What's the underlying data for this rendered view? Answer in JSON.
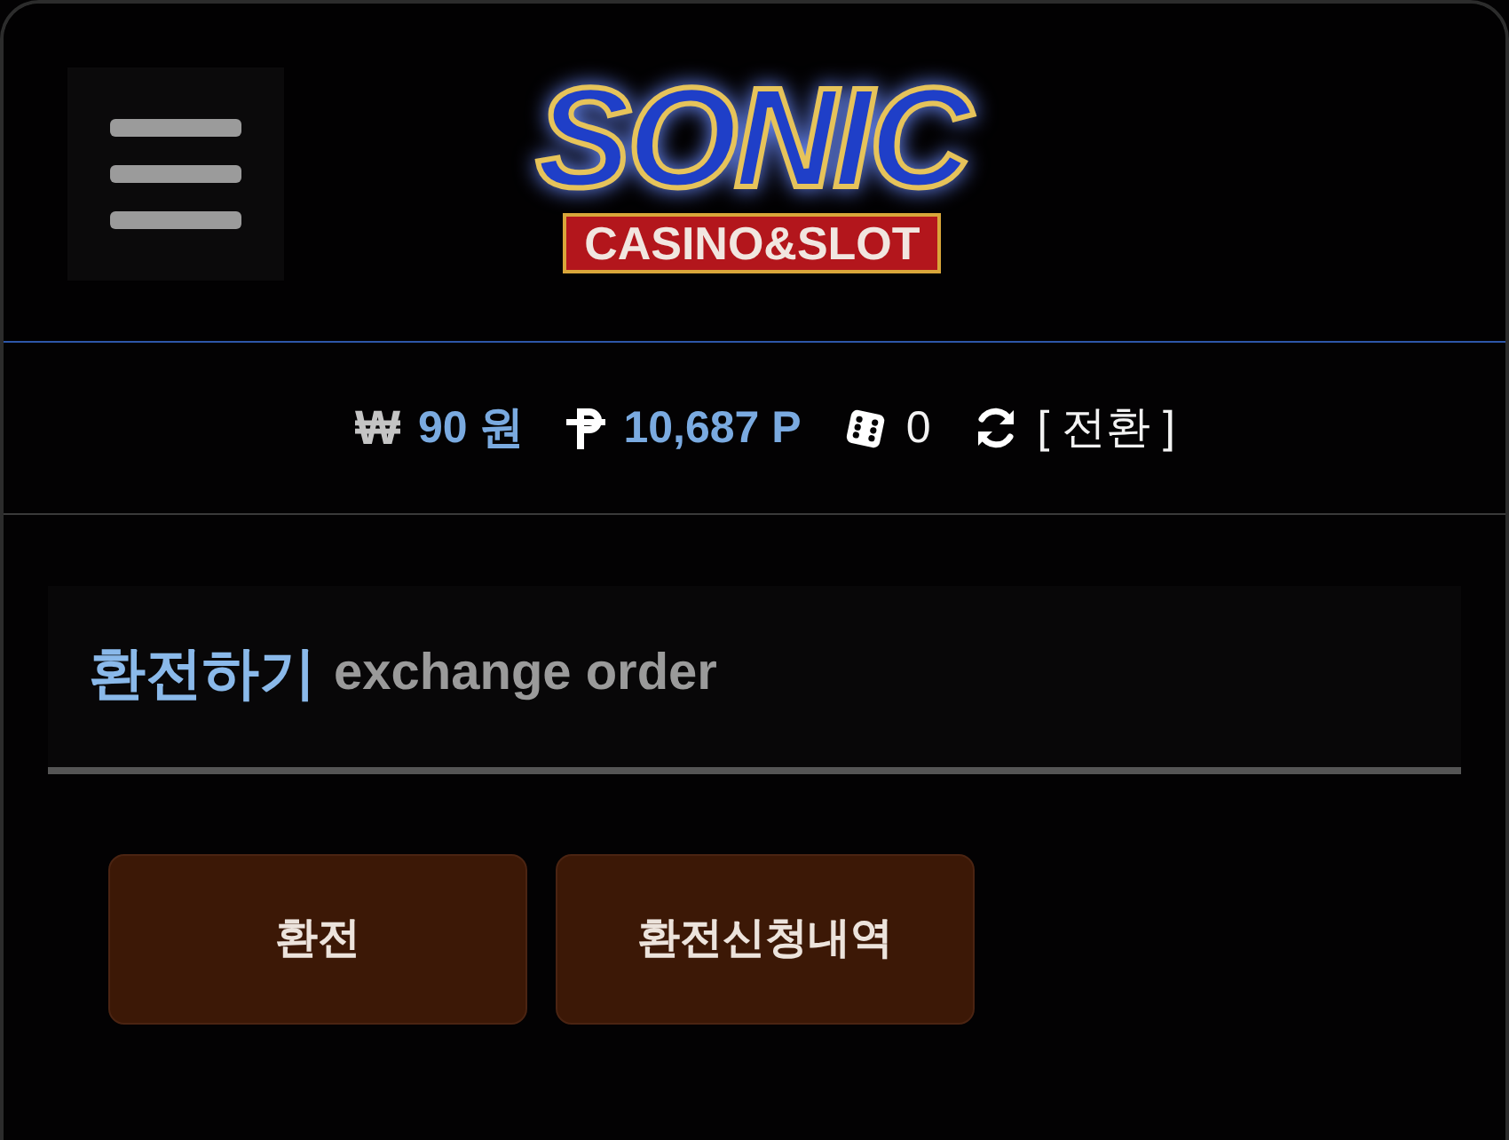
{
  "header": {
    "logo": {
      "title": "SONIC",
      "subtitle": "CASINO&SLOT"
    }
  },
  "balance_bar": {
    "items": [
      {
        "kind": "cash",
        "symbol": "₩",
        "amount": "90 원"
      },
      {
        "kind": "points",
        "amount": "10,687 P"
      },
      {
        "kind": "dice",
        "amount": "0"
      },
      {
        "kind": "convert",
        "label": "[ 전환 ]"
      }
    ]
  },
  "section": {
    "title": "환전하기",
    "subtitle": "exchange order"
  },
  "buttons": [
    {
      "label": "환전"
    },
    {
      "label": "환전신청내역"
    }
  ]
}
